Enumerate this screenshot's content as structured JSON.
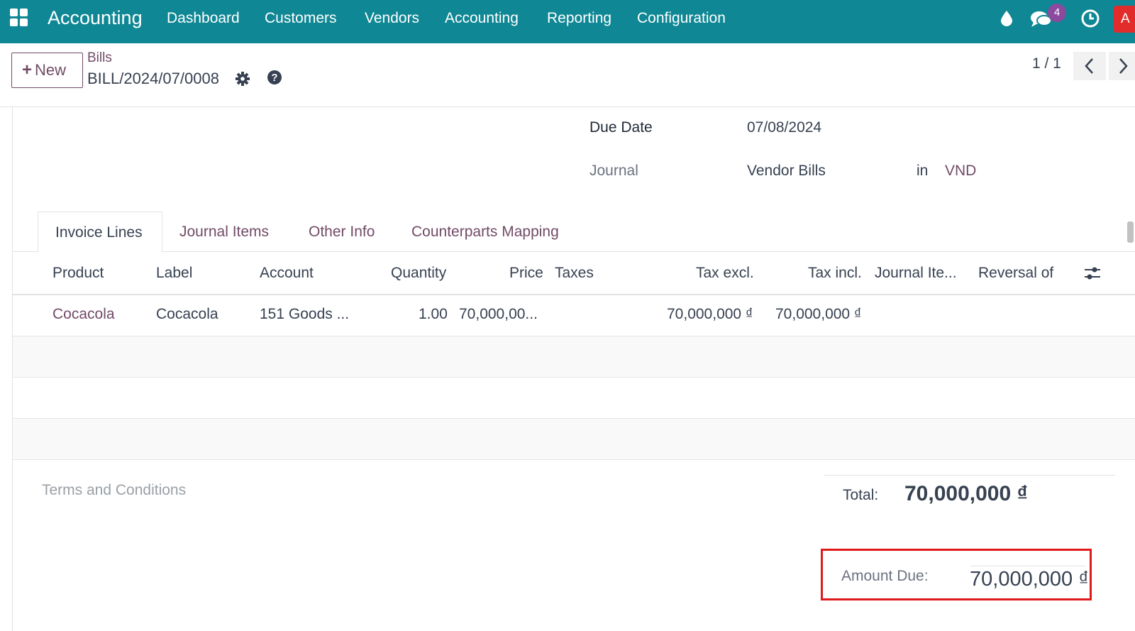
{
  "navbar": {
    "brand": "Accounting",
    "menu": [
      "Dashboard",
      "Customers",
      "Vendors",
      "Accounting",
      "Reporting",
      "Configuration"
    ],
    "message_count": "4",
    "avatar_letter": "A"
  },
  "control_panel": {
    "new_label": "New",
    "breadcrumb": "Bills",
    "record_name": "BILL/2024/07/0008",
    "pager": "1 / 1"
  },
  "form": {
    "due_date_label": "Due Date",
    "due_date_value": "07/08/2024",
    "journal_label": "Journal",
    "journal_value": "Vendor Bills",
    "in_label": "in",
    "currency": "VND"
  },
  "tabs": [
    {
      "label": "Invoice Lines",
      "active": true
    },
    {
      "label": "Journal Items",
      "active": false
    },
    {
      "label": "Other Info",
      "active": false
    },
    {
      "label": "Counterparts Mapping",
      "active": false
    }
  ],
  "table": {
    "columns": [
      "Product",
      "Label",
      "Account",
      "Quantity",
      "Price",
      "Taxes",
      "Tax excl.",
      "Tax incl.",
      "Journal Ite...",
      "Reversal of"
    ],
    "rows": [
      {
        "product": "Cocacola",
        "label": "Cocacola",
        "account": "151 Goods ...",
        "quantity": "1.00",
        "price": "70,000,00...",
        "taxes": "",
        "tax_excl": "70,000,000 ₫",
        "tax_incl": "70,000,000 ₫",
        "journal_item": "",
        "reversal_of": ""
      }
    ]
  },
  "footer": {
    "terms_placeholder": "Terms and Conditions",
    "total_label": "Total:",
    "total_value": "70,000,000 ₫",
    "amount_due_label": "Amount Due:",
    "amount_due_value": "70,000,000 ₫"
  },
  "colors": {
    "navbar": "#0f8794",
    "brand_purple": "#714b67",
    "highlight_red": "#e01a1a"
  }
}
